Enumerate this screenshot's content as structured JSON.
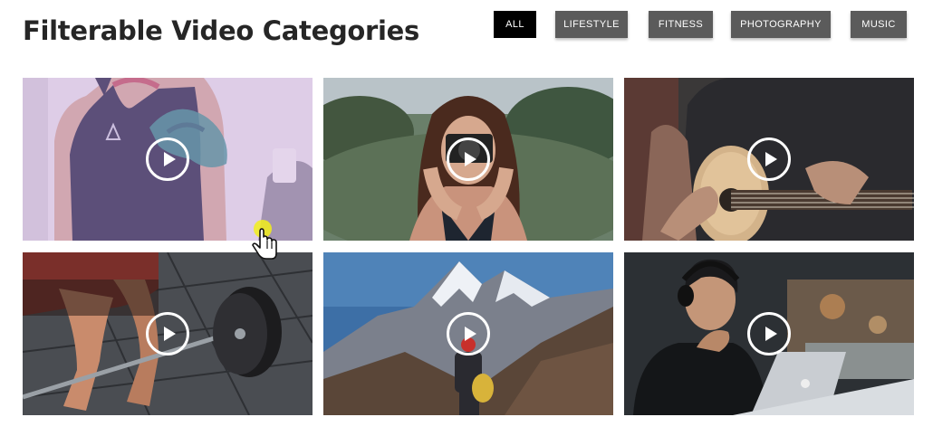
{
  "header": {
    "title": "Filterable Video Categories"
  },
  "filters": [
    {
      "label": "ALL",
      "active": true
    },
    {
      "label": "LIFESTYLE",
      "active": false
    },
    {
      "label": "FITNESS",
      "active": false
    },
    {
      "label": "PHOTOGRAPHY",
      "active": false
    },
    {
      "label": "MUSIC",
      "active": false
    }
  ],
  "videos": [
    {
      "subject": "tattooed woman in black tank top",
      "hovered": true
    },
    {
      "subject": "woman holding camera"
    },
    {
      "subject": "man playing acoustic guitar"
    },
    {
      "subject": "weightlifter with barbell"
    },
    {
      "subject": "hiker facing snowy mountains"
    },
    {
      "subject": "man with headphones at laptop"
    }
  ],
  "icons": {
    "play": "play-circle-icon",
    "cursor": "hand-pointer-icon"
  },
  "colors": {
    "active_filter": "#000000",
    "filter": "#5b5b5b",
    "filter_text": "#ffffff",
    "hover_overlay": "#c7a6de",
    "title": "#262626"
  }
}
